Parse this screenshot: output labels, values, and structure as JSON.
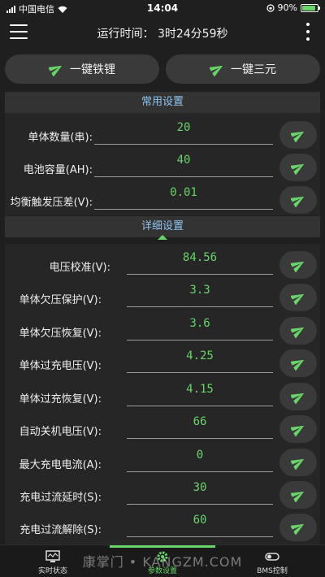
{
  "status_bar": {
    "carrier": "中国电信",
    "time": "14:04",
    "battery": "90%",
    "battery_level": 0.9
  },
  "app_bar": {
    "runtime": "运行时间：  3时24分59秒"
  },
  "quick_actions": [
    {
      "label": "一键铁锂",
      "icon": "send-icon"
    },
    {
      "label": "一键三元",
      "icon": "send-icon"
    }
  ],
  "common_settings": {
    "title": "常用设置",
    "rows": [
      {
        "label": "单体数量(串):",
        "value": "20"
      },
      {
        "label": "电池容量(AH):",
        "value": "40"
      },
      {
        "label": "均衡触发压差(V):",
        "value": "0.01"
      }
    ]
  },
  "detail_settings": {
    "title": "详细设置",
    "rows": [
      {
        "label": "电压校准(V):",
        "value": "84.56"
      },
      {
        "label": "单体欠压保护(V):",
        "value": "3.3"
      },
      {
        "label": "单体欠压恢复(V):",
        "value": "3.6"
      },
      {
        "label": "单体过充电压(V):",
        "value": "4.25"
      },
      {
        "label": "单体过充恢复(V):",
        "value": "4.15"
      },
      {
        "label": "自动关机电压(V):",
        "value": "66"
      },
      {
        "label": "最大充电电流(A):",
        "value": "0"
      },
      {
        "label": "充电过流延时(S):",
        "value": "30"
      },
      {
        "label": "充电过流解除(S):",
        "value": "60"
      }
    ]
  },
  "tabs": [
    {
      "label": "实时状态",
      "icon": "monitor-icon"
    },
    {
      "label": "参数设置",
      "icon": "gear-icon",
      "active": true
    },
    {
      "label": "BMS控制",
      "icon": "toggle-icon"
    }
  ],
  "watermark": "康掌门 • KANGZM.COM",
  "colors": {
    "accent": "#6ad46a",
    "section_title": "#8ec4f0",
    "background": "#1f1f1f"
  }
}
